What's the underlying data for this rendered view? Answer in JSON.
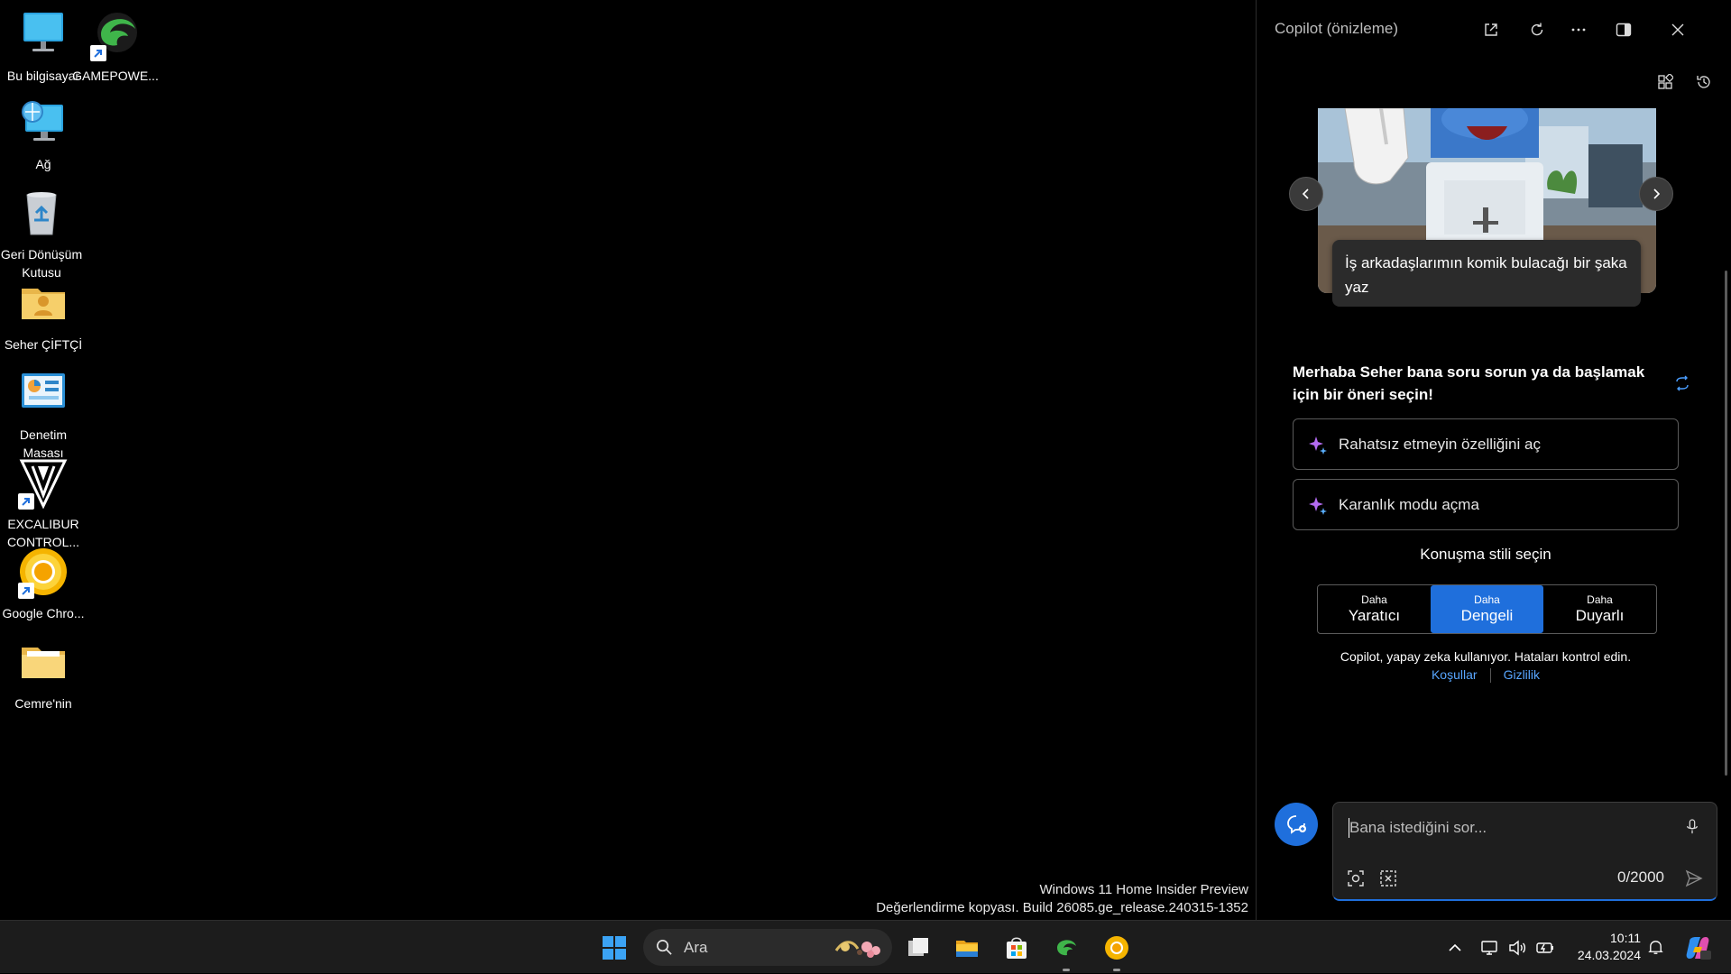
{
  "desktop": {
    "icons": [
      {
        "label": "Bu bilgisayar",
        "icon": "computer-icon"
      },
      {
        "label": "GAMEPOWE...",
        "icon": "gamepower-icon"
      },
      {
        "label": "Ağ",
        "icon": "network-icon"
      },
      {
        "label": "Geri Dönüşüm Kutusu",
        "icon": "recycle-bin-icon"
      },
      {
        "label": "Seher ÇİFTÇİ",
        "icon": "user-folder-icon"
      },
      {
        "label": "Denetim Masası",
        "icon": "control-panel-icon"
      },
      {
        "label": "EXCALIBUR CONTROL...",
        "icon": "excalibur-icon"
      },
      {
        "label": "Google Chro...",
        "icon": "chrome-icon"
      },
      {
        "label": "Cemre'nin",
        "icon": "folder-icon"
      }
    ],
    "watermark_line1": "Windows 11 Home Insider Preview",
    "watermark_line2": "Değerlendirme kopyası. Build 26085.ge_release.240315-1352"
  },
  "copilot": {
    "title": "Copilot (önizleme)",
    "hero_caption": "İş arkadaşlarımın komik bulacağı bir şaka yaz",
    "greeting": "Merhaba Seher bana soru sorun ya da başlamak için bir öneri seçin!",
    "suggestions": [
      "Rahatsız etmeyin özelliğini aç",
      "Karanlık modu açma"
    ],
    "style_title": "Konuşma stili seçin",
    "styles": [
      {
        "small": "Daha",
        "big": "Yaratıcı"
      },
      {
        "small": "Daha",
        "big": "Dengeli"
      },
      {
        "small": "Daha",
        "big": "Duyarlı"
      }
    ],
    "disclaimer": "Copilot, yapay zeka kullanıyor. Hataları kontrol edin.",
    "link_terms": "Koşullar",
    "link_privacy": "Gizlilik",
    "input_placeholder": "Bana istediğini sor...",
    "counter": "0/2000",
    "accent": "#1f6fdc"
  },
  "taskbar": {
    "search_label": "Ara",
    "time": "10:11",
    "date": "24.03.2024"
  }
}
